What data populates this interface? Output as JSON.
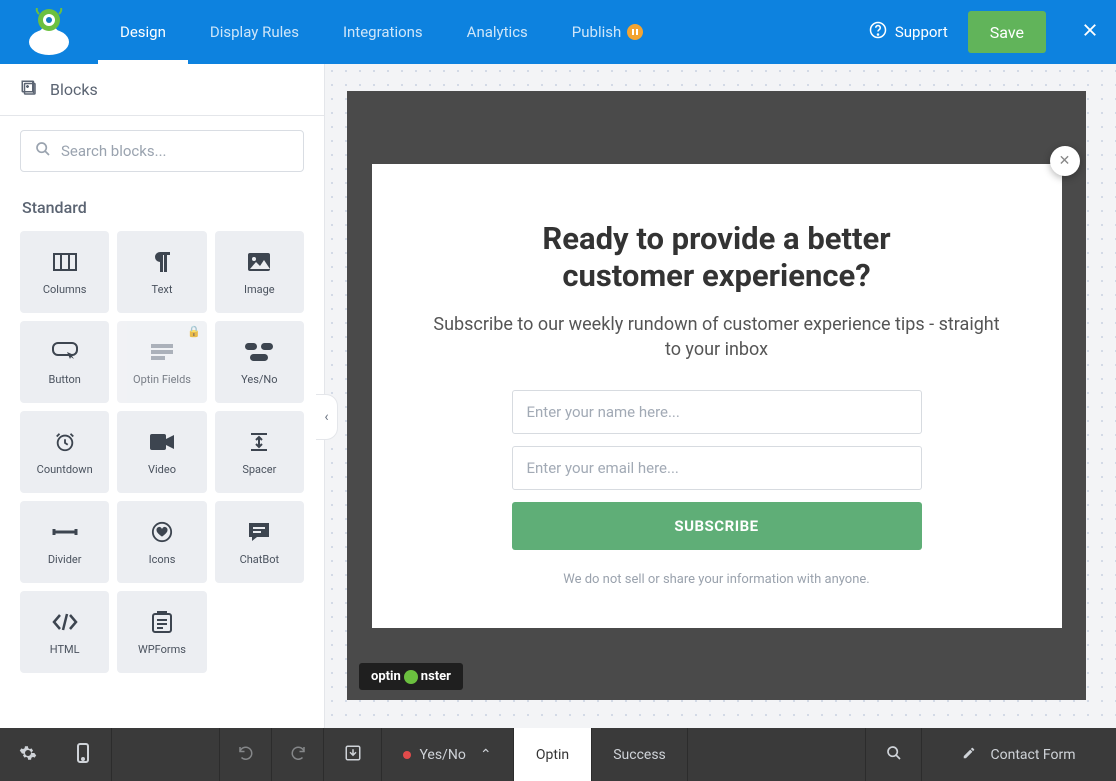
{
  "nav": {
    "tabs": [
      "Design",
      "Display Rules",
      "Integrations",
      "Analytics",
      "Publish"
    ],
    "publish_badge_color": "#f3a431",
    "support": "Support",
    "save": "Save"
  },
  "sidebar": {
    "header": "Blocks",
    "search_placeholder": "Search blocks...",
    "section": "Standard",
    "blocks": [
      {
        "label": "Columns",
        "icon": "columns"
      },
      {
        "label": "Text",
        "icon": "paragraph"
      },
      {
        "label": "Image",
        "icon": "image"
      },
      {
        "label": "Button",
        "icon": "button"
      },
      {
        "label": "Optin Fields",
        "icon": "form",
        "locked": true
      },
      {
        "label": "Yes/No",
        "icon": "toggle"
      },
      {
        "label": "Countdown",
        "icon": "clock"
      },
      {
        "label": "Video",
        "icon": "video"
      },
      {
        "label": "Spacer",
        "icon": "spacer"
      },
      {
        "label": "Divider",
        "icon": "divider"
      },
      {
        "label": "Icons",
        "icon": "heart"
      },
      {
        "label": "ChatBot",
        "icon": "chat"
      },
      {
        "label": "HTML",
        "icon": "code"
      },
      {
        "label": "WPForms",
        "icon": "wpforms"
      }
    ]
  },
  "popup": {
    "title_line1": "Ready to provide a better",
    "title_line2": "customer experience?",
    "subtitle": "Subscribe to our weekly rundown of customer experience tips - straight to your inbox",
    "name_placeholder": "Enter your name here...",
    "email_placeholder": "Enter your email here...",
    "button": "SUBSCRIBE",
    "note": "We do not sell or share your information with anyone.",
    "brand": "optinmonster"
  },
  "bottombar": {
    "yesno": "Yes/No",
    "optin": "Optin",
    "success": "Success",
    "form_name": "Contact Form"
  }
}
